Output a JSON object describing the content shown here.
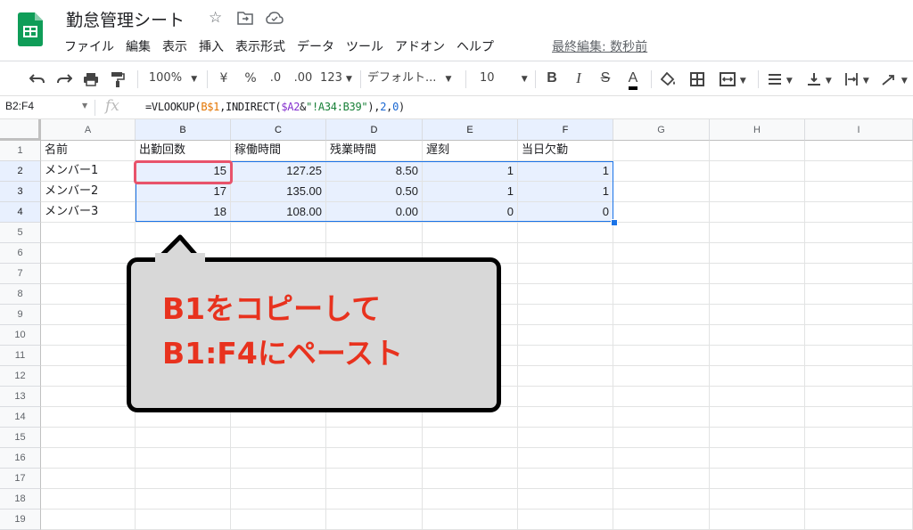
{
  "app": {
    "title": "勤怠管理シート",
    "menus": [
      "ファイル",
      "編集",
      "表示",
      "挿入",
      "表示形式",
      "データ",
      "ツール",
      "アドオン",
      "ヘルプ"
    ],
    "last_edit": "最終編集: 数秒前"
  },
  "toolbar": {
    "zoom": "100%",
    "currency": "¥",
    "percent": "%",
    "decrease_decimal": ".0",
    "increase_decimal": ".00",
    "more_formats": "123",
    "font": "デフォルト...",
    "font_size": "10",
    "bold": "B",
    "italic": "I",
    "strike": "S",
    "text_color": "A"
  },
  "formula_bar": {
    "name_box": "B2:F4",
    "fx": "fx",
    "formula": {
      "p1": "=VLOOKUP(",
      "p2": "B$1",
      "p3": ",INDIRECT(",
      "p4": "$A2",
      "p5": "&",
      "p6": "\"!A34:B39\"",
      "p7": "),",
      "p8": "2",
      "p9": ",",
      "p10": "0",
      "p11": ")"
    }
  },
  "grid": {
    "columns": [
      "A",
      "B",
      "C",
      "D",
      "E",
      "F",
      "G",
      "H",
      "I"
    ],
    "rows": [
      "1",
      "2",
      "3",
      "4",
      "5",
      "6",
      "7",
      "8",
      "9",
      "10",
      "11",
      "12",
      "13",
      "14",
      "15",
      "16",
      "17",
      "18",
      "19"
    ],
    "header_row": [
      "名前",
      "出勤回数",
      "稼働時間",
      "残業時間",
      "遅刻",
      "当日欠勤"
    ],
    "data": [
      [
        "メンバー1",
        "15",
        "127.25",
        "8.50",
        "1",
        "1"
      ],
      [
        "メンバー2",
        "17",
        "135.00",
        "0.50",
        "1",
        "1"
      ],
      [
        "メンバー3",
        "18",
        "108.00",
        "0.00",
        "0",
        "0"
      ]
    ]
  },
  "callout": {
    "line1": "B1をコピーして",
    "line2": "B1:F4にペースト"
  },
  "colors": {
    "accent": "#1a73e8",
    "selection": "#e8f0fe",
    "highlight_border": "#e8536b",
    "callout_text": "#e8321e",
    "sheets_green": "#0f9d58"
  }
}
